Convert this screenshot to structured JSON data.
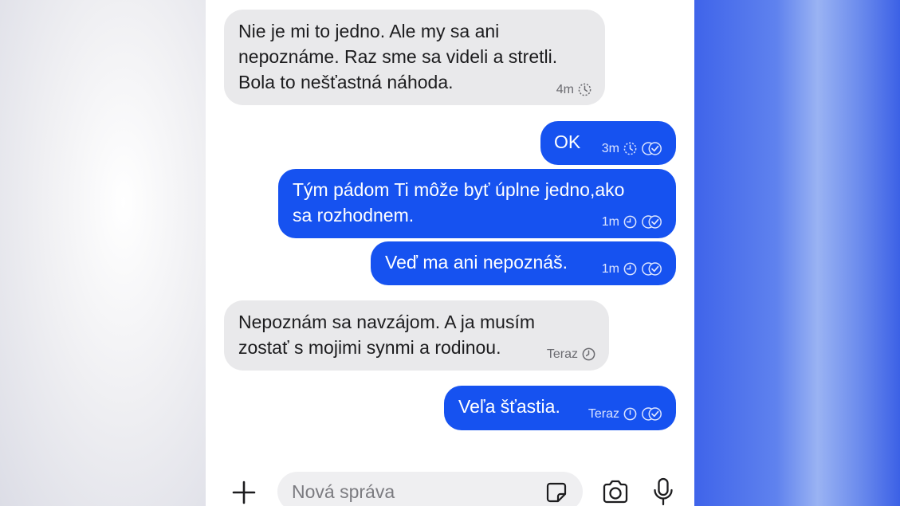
{
  "messages": [
    {
      "direction": "in",
      "text": "Nie je mi to jedno. Ale my sa ani\nnepoznáme. Raz sme sa videli a stretli.\nBola to nešťastná náhoda.",
      "time": "4m",
      "status_icon": "pending-dotted-clock-icon"
    },
    {
      "direction": "out",
      "text": "OK",
      "time": "3m",
      "status_icon": "read-double-check-icon"
    },
    {
      "direction": "out",
      "text": "Tým pádom Ti môže byť úplne jedno,ako\nsa rozhodnem.",
      "time": "1m",
      "status_icon": "read-double-check-icon"
    },
    {
      "direction": "out",
      "text": "Veď ma ani nepoznáš.",
      "time": "1m",
      "status_icon": "read-double-check-icon"
    },
    {
      "direction": "in",
      "text": "Nepoznám sa navzájom. A ja musím\nzostať s mojimi synmi a rodinou.",
      "time": "Teraz",
      "status_icon": "timer-icon"
    },
    {
      "direction": "out",
      "text": "Veľa šťastia.",
      "time": "Teraz",
      "status_icon": "read-double-check-icon"
    }
  ],
  "composer": {
    "placeholder": "Nová správa",
    "value": "",
    "icons": [
      "plus-icon",
      "sticker-icon",
      "camera-icon",
      "microphone-icon"
    ]
  },
  "colors": {
    "outgoing_bubble": "#1652f0",
    "incoming_bubble": "#e9e9eb",
    "outgoing_text": "#ffffff",
    "incoming_text": "#1c1c1e"
  }
}
